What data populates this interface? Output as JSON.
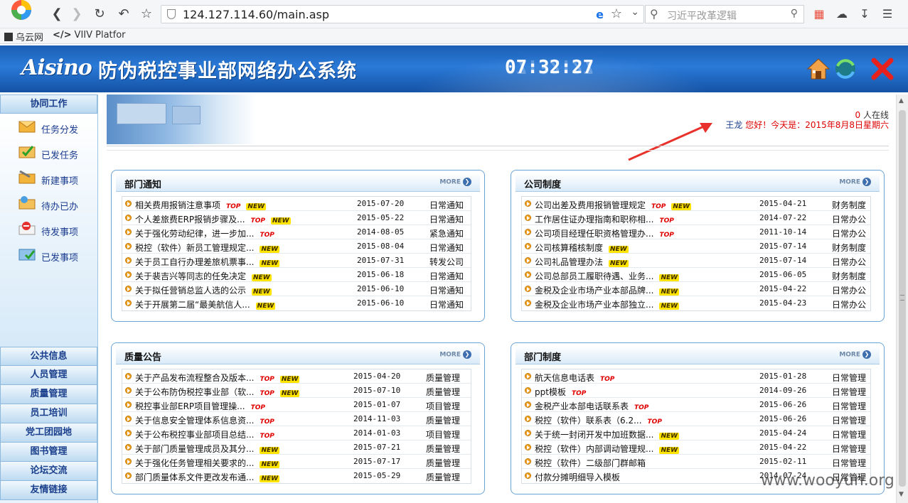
{
  "browser": {
    "url": "124.127.114.60/main.asp",
    "search_placeholder": "习近平改革逻辑",
    "bookmarks": [
      "乌云网",
      "VIIV Platfor"
    ]
  },
  "header": {
    "logo": "Aisino",
    "title": "防伪税控事业部网络办公系统",
    "clock": "07:32:27"
  },
  "sidebar": {
    "section_title": "协同工作",
    "items": [
      "任务分发",
      "已发任务",
      "新建事项",
      "待办已办",
      "待发事项",
      "已发事项"
    ],
    "menu": [
      "公共信息",
      "人员管理",
      "质量管理",
      "员工培训",
      "党工团园地",
      "图书管理",
      "论坛交流",
      "友情链接"
    ]
  },
  "status": {
    "online_count": "0",
    "online_suffix": "人在线",
    "user": "王龙",
    "greeting": "您好！今天是：2015年8月8日星期六"
  },
  "more_label": "MORE",
  "panels": [
    {
      "title": "部门通知",
      "rows": [
        {
          "title": "相关费用报销注意事项",
          "top": true,
          "new": true,
          "date": "2015-07-20",
          "category": "日常通知"
        },
        {
          "title": "个人差旅费ERP报销步骤及...",
          "top": true,
          "new": true,
          "date": "2015-05-22",
          "category": "日常通知"
        },
        {
          "title": "关于强化劳动纪律，进一步加...",
          "top": true,
          "new": false,
          "date": "2014-08-05",
          "category": "紧急通知"
        },
        {
          "title": "税控（软件）新员工管理规定...",
          "top": false,
          "new": true,
          "date": "2015-08-04",
          "category": "日常通知"
        },
        {
          "title": "关于员工自行办理差旅机票事...",
          "top": false,
          "new": true,
          "date": "2015-07-31",
          "category": "转发公司"
        },
        {
          "title": "关于裴吉兴等同志的任免决定",
          "top": false,
          "new": true,
          "date": "2015-06-18",
          "category": "日常通知"
        },
        {
          "title": "关于拟任营销总监人选的公示",
          "top": false,
          "new": true,
          "date": "2015-06-10",
          "category": "日常通知"
        },
        {
          "title": "关于开展第二届“最美航信人...",
          "top": false,
          "new": true,
          "date": "2015-06-10",
          "category": "日常通知"
        }
      ]
    },
    {
      "title": "公司制度",
      "rows": [
        {
          "title": "公司出差及费用报销管理规定",
          "top": true,
          "new": true,
          "date": "2015-04-21",
          "category": "财务制度"
        },
        {
          "title": "工作居住证办理指南和职称相...",
          "top": true,
          "new": false,
          "date": "2014-07-22",
          "category": "日常办公"
        },
        {
          "title": "公司项目经理任职资格管理办...",
          "top": true,
          "new": false,
          "date": "2011-10-14",
          "category": "日常办公"
        },
        {
          "title": "公司核算稽核制度",
          "top": false,
          "new": true,
          "date": "2015-07-14",
          "category": "财务制度"
        },
        {
          "title": "公司礼品管理办法",
          "top": false,
          "new": true,
          "date": "2015-07-14",
          "category": "日常办公"
        },
        {
          "title": "公司总部员工履职待遇、业务...",
          "top": false,
          "new": true,
          "date": "2015-06-05",
          "category": "财务制度"
        },
        {
          "title": "金税及企业市场产业本部品牌...",
          "top": false,
          "new": true,
          "date": "2015-04-22",
          "category": "日常办公"
        },
        {
          "title": "金税及企业市场产业本部独立...",
          "top": false,
          "new": true,
          "date": "2015-04-23",
          "category": "日常办公"
        }
      ]
    },
    {
      "title": "质量公告",
      "rows": [
        {
          "title": "关于产品发布流程整合及版本...",
          "top": true,
          "new": true,
          "date": "2015-04-20",
          "category": "质量管理"
        },
        {
          "title": "关于公布防伪税控事业部（软...",
          "top": true,
          "new": true,
          "date": "2015-07-10",
          "category": "质量管理"
        },
        {
          "title": "税控事业部ERP项目管理操...",
          "top": true,
          "new": false,
          "date": "2015-01-07",
          "category": "项目管理"
        },
        {
          "title": "关于信息安全管理体系信息资...",
          "top": true,
          "new": false,
          "date": "2014-11-03",
          "category": "质量管理"
        },
        {
          "title": "关于公布税控事业部项目总结...",
          "top": true,
          "new": false,
          "date": "2014-01-03",
          "category": "项目管理"
        },
        {
          "title": "关于部门质量管理成员及其分...",
          "top": false,
          "new": true,
          "date": "2015-07-21",
          "category": "质量管理"
        },
        {
          "title": "关于强化任务管理相关要求的...",
          "top": false,
          "new": true,
          "date": "2015-07-17",
          "category": "质量管理"
        },
        {
          "title": "部门质量体系文件更改发布通...",
          "top": false,
          "new": true,
          "date": "2015-05-29",
          "category": "质量管理"
        }
      ]
    },
    {
      "title": "部门制度",
      "rows": [
        {
          "title": "航天信息电话表",
          "top": true,
          "new": false,
          "date": "2015-01-28",
          "category": "日常管理"
        },
        {
          "title": "ppt模板",
          "top": true,
          "new": false,
          "date": "2014-09-26",
          "category": "日常管理"
        },
        {
          "title": "金税产业本部电话联系表",
          "top": true,
          "new": false,
          "date": "2015-06-26",
          "category": "日常管理"
        },
        {
          "title": "税控（软件）联系表（6.2...",
          "top": true,
          "new": false,
          "date": "2015-06-26",
          "category": "日常管理"
        },
        {
          "title": "关于统一封闭开发中加班数据...",
          "top": false,
          "new": true,
          "date": "2015-04-24",
          "category": "日常管理"
        },
        {
          "title": "税控（软件）内部调动管理规...",
          "top": false,
          "new": true,
          "date": "2015-04-22",
          "category": "日常管理"
        },
        {
          "title": "税控（软件）二级部门群邮箱",
          "top": false,
          "new": false,
          "date": "2015-02-11",
          "category": "日常管理"
        },
        {
          "title": "付款分摊明细导入模板",
          "top": false,
          "new": false,
          "date": "2014-07-24",
          "category": "日常管理"
        }
      ]
    }
  ],
  "tags": {
    "top": "TOP",
    "new": "NEW"
  },
  "watermark": "www.wooyun.org"
}
